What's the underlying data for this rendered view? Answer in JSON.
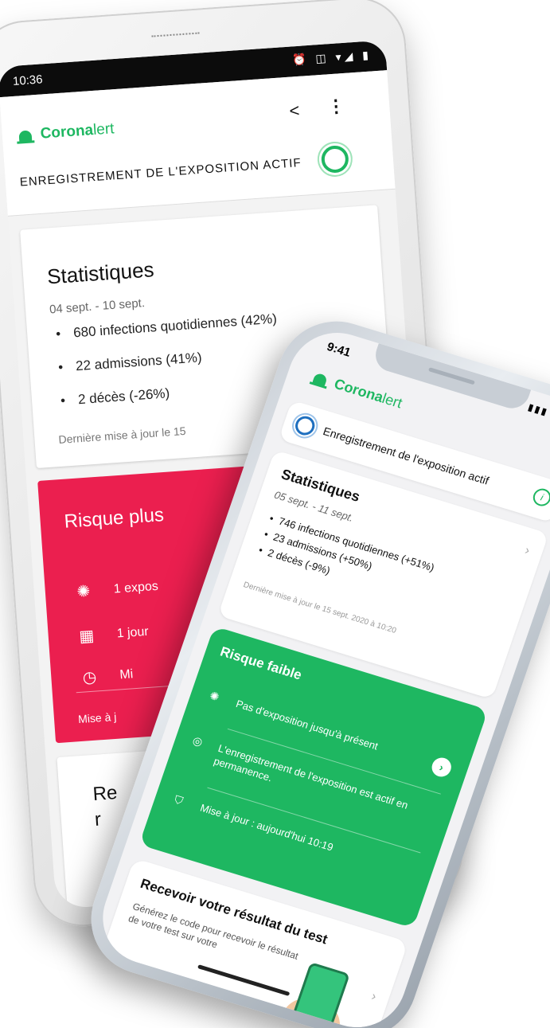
{
  "android": {
    "status": {
      "time": "10:36",
      "icons": "⏰ ◫ ▾◢ ▮"
    },
    "app": {
      "logo_bold": "Corona",
      "logo_light": "lert",
      "exposure_banner": "ENREGISTREMENT DE L'EXPOSITION ACTIF"
    },
    "stats": {
      "title": "Statistiques",
      "period": "04 sept. - 10 sept.",
      "items": [
        "680 infections quotidiennes (42%)",
        "22 admissions (41%)",
        "2 décès (-26%)"
      ],
      "updated": "Dernière mise à jour le 15"
    },
    "risk": {
      "title": "Risque plus",
      "rows": [
        {
          "icon": "virus-icon",
          "text": "1 expos"
        },
        {
          "icon": "calendar-icon",
          "text": "1 jour"
        },
        {
          "icon": "clock-icon",
          "text": "Mi"
        }
      ],
      "footer": "Mise à j"
    },
    "test_card": {
      "line1": "Re",
      "line2": "r"
    }
  },
  "iphone": {
    "status": {
      "time": "9:41",
      "icons": "▮▮▮ ◠ ▭"
    },
    "app": {
      "logo_bold": "Corona",
      "logo_light": "lert"
    },
    "exposure": {
      "label": "Enregistrement de l'exposition actif",
      "info": "i"
    },
    "stats": {
      "title": "Statistiques",
      "period": "05 sept. - 11 sept.",
      "items": [
        "746 infections quotidiennes (+51%)",
        "23 admissions (+50%)",
        "2 décès (-9%)"
      ],
      "updated": "Dernière mise à jour le 15 sept. 2020 à 10:20"
    },
    "risk": {
      "title": "Risque faible",
      "rows": [
        {
          "icon": "virus-icon",
          "text": "Pas d'exposition jusqu'à présent"
        },
        {
          "icon": "check-circle-icon",
          "text": "L'enregistrement de l'exposition est actif en permanence."
        },
        {
          "icon": "shield-icon",
          "text": "Mise à jour : aujourd'hui 10:19"
        }
      ]
    },
    "test": {
      "title": "Recevoir votre résultat du test",
      "description": "Générez le code pour recevoir le résultat de votre test sur votre"
    }
  },
  "colors": {
    "brand_green": "#1eb761",
    "risk_red": "#eb1f4f",
    "pulse_blue": "#1e6fbf"
  }
}
